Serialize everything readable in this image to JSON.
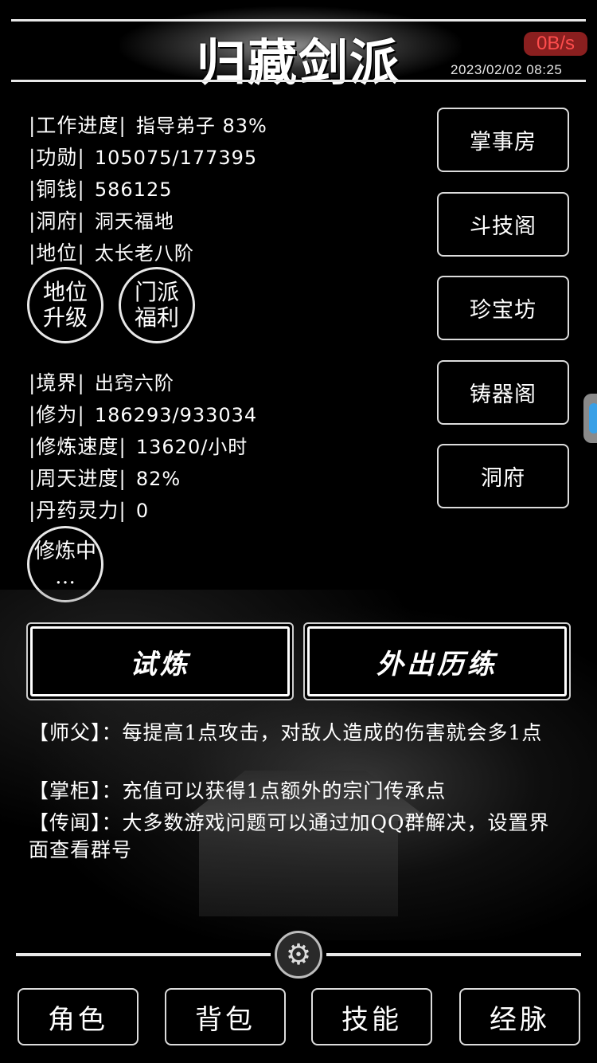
{
  "header": {
    "title": "归藏剑派",
    "speed": "0B/s",
    "datetime": "2023/02/02 08:25"
  },
  "stats_top": [
    {
      "label": "|工作进度|",
      "value": "指导弟子 83%"
    },
    {
      "label": "|功勋|",
      "value": "105075/177395"
    },
    {
      "label": "|铜钱|",
      "value": "586125"
    },
    {
      "label": "|洞府|",
      "value": "洞天福地"
    },
    {
      "label": "|地位|",
      "value": "太长老八阶"
    }
  ],
  "circle_buttons": {
    "upgrade": {
      "line1": "地位",
      "line2": "升级"
    },
    "welfare": {
      "line1": "门派",
      "line2": "福利"
    },
    "cultivating": {
      "line1": "修炼中",
      "line2": "…"
    }
  },
  "stats_bottom": [
    {
      "label": "|境界|",
      "value": "出窍六阶"
    },
    {
      "label": "|修为|",
      "value": "186293/933034"
    },
    {
      "label": "|修炼速度|",
      "value": "13620/小时"
    },
    {
      "label": "|周天进度|",
      "value": "82%"
    },
    {
      "label": "|丹药灵力|",
      "value": "0"
    }
  ],
  "right_menu": [
    "掌事房",
    "斗技阁",
    "珍宝坊",
    "铸器阁",
    "洞府"
  ],
  "actions": {
    "trial": "试炼",
    "travel": "外出历练"
  },
  "messages": [
    "【师父】：每提高1点攻击，对敌人造成的伤害就会多1点",
    "【掌柜】：充值可以获得1点额外的宗门传承点",
    "【传闻】：大多数游戏问题可以通过加QQ群解决，设置界面查看群号"
  ],
  "bottom_nav": [
    "角色",
    "背包",
    "技能",
    "经脉"
  ],
  "icons": {
    "settings": "gear-icon",
    "side": "floating-tab-icon"
  },
  "colors": {
    "speed_badge_bg": "#8a1f1f",
    "speed_badge_text": "#ff4d4d",
    "side_tab": "#3aa0e6"
  }
}
